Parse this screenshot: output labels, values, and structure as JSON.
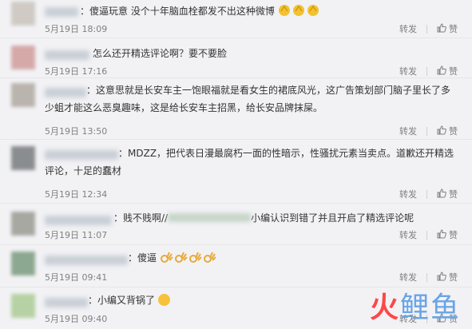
{
  "comments": [
    {
      "prefix": "：傻逼玩意  没个十年脑血栓都发不出这种微博",
      "time": "5月19日 18:09",
      "repost": "转发",
      "like": "赞",
      "avatar_color": "#cfcac4"
    },
    {
      "prefix": "怎么还开精选评论啊？要不要脸",
      "time": "5月19日 17:16",
      "repost": "转发",
      "like": "赞",
      "avatar_color": "#d6a9a9"
    },
    {
      "prefix": "：这意思就是长安车主一饱眼福就是看女生的裙底风光，这广告策划部门脑子里长了多少蛆才能这么恶臭趣味，这是给长安车主招黑，给长安品牌抹屎。",
      "time": "5月19日 13:50",
      "repost": "转发",
      "like": "赞",
      "avatar_color": "#b9b4ad"
    },
    {
      "prefix": "：MDZZ，把代表日漫最腐朽一面的性暗示，性骚扰元素当卖点。道歉还开精选评论，十足的蠢材",
      "time": "5月19日 12:34",
      "repost": "转发",
      "like": "赞",
      "avatar_color": "#8a8d8f"
    },
    {
      "prefix": "：贱不贱啊//",
      "suffix": "小编认识到错了并且开启了精选评论呢",
      "time": "5月19日 11:07",
      "repost": "转发",
      "like": "赞",
      "avatar_color": "#a8a8a2"
    },
    {
      "prefix": "：傻逼",
      "time": "5月19日 09:41",
      "repost": "转发",
      "like": "赞",
      "avatar_color": "#8ca890"
    },
    {
      "prefix": "：小编又背锅了",
      "time": "5月19日 09:40",
      "repost": "转发",
      "like": "赞",
      "avatar_color": "#b6d1a4"
    }
  ],
  "watermark": {
    "part1": "火",
    "part2": "鲤",
    "part3": "鱼"
  },
  "colors": {
    "text": "#333333",
    "meta": "#808080",
    "watermark_red": "#ff4747",
    "watermark_blue": "#6aa5e5"
  }
}
